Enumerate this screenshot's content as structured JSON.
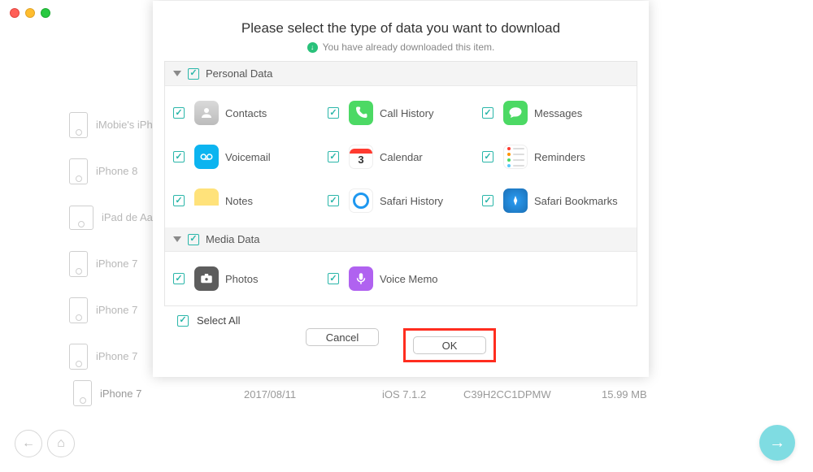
{
  "traffic": {},
  "bg_devices": [
    "iMobie's iPh",
    "iPhone 8",
    "iPad de Aar",
    "iPhone 7",
    "iPhone 7",
    "iPhone 7"
  ],
  "footer": {
    "name": "iPhone 7",
    "date": "2017/08/11",
    "ios": "iOS 7.1.2",
    "sn": "C39H2CC1DPMW",
    "size": "15.99 MB"
  },
  "modal": {
    "title": "Please select the type of data you want to download",
    "sub": "You have already downloaded this item.",
    "group_personal": "Personal Data",
    "group_media": "Media Data",
    "personal_items": [
      {
        "k": "contacts",
        "label": "Contacts"
      },
      {
        "k": "call",
        "label": "Call History"
      },
      {
        "k": "msg",
        "label": "Messages"
      },
      {
        "k": "vm",
        "label": "Voicemail"
      },
      {
        "k": "cal",
        "label": "Calendar"
      },
      {
        "k": "rem",
        "label": "Reminders"
      },
      {
        "k": "notes",
        "label": "Notes"
      },
      {
        "k": "safh",
        "label": "Safari History"
      },
      {
        "k": "safb",
        "label": "Safari Bookmarks"
      }
    ],
    "media_items": [
      {
        "k": "photo",
        "label": "Photos"
      },
      {
        "k": "voice",
        "label": "Voice Memo"
      }
    ],
    "cal_day": "3",
    "select_all": "Select All",
    "cancel": "Cancel",
    "ok": "OK"
  }
}
